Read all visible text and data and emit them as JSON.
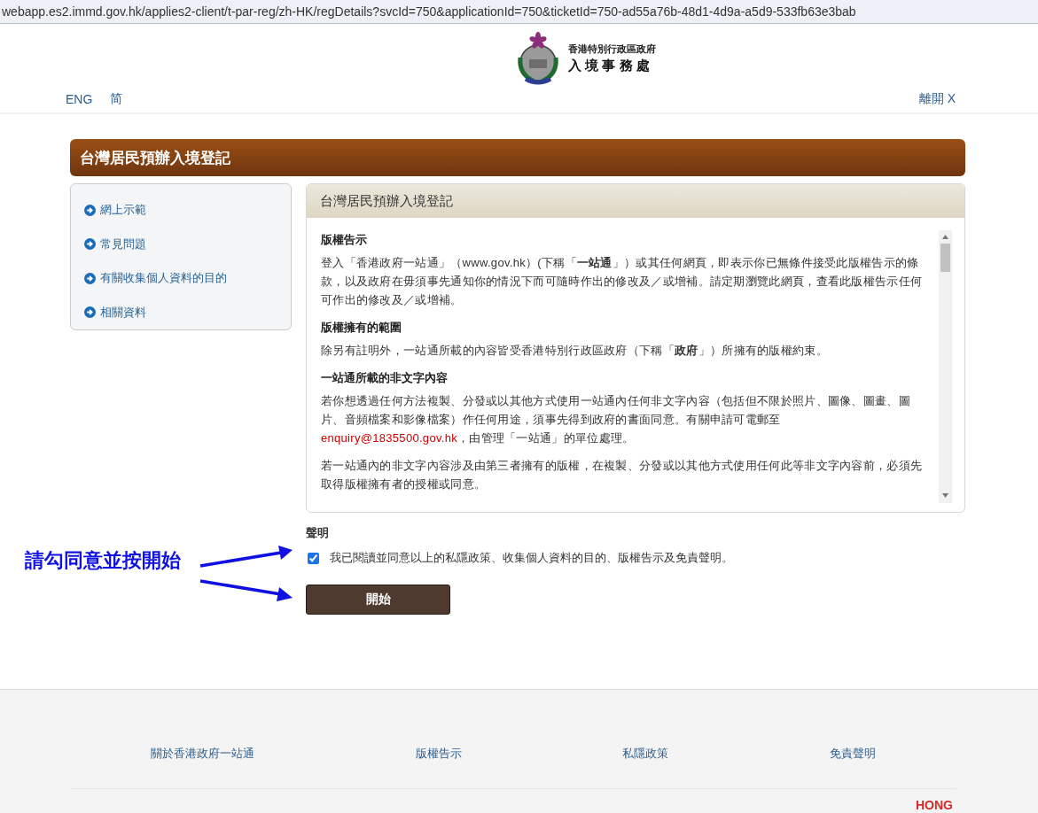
{
  "address_bar": {
    "url": "webapp.es2.immd.gov.hk/applies2-client/t-par-reg/zh-HK/regDetails?svcId=750&applicationId=750&ticketId=750-ad55a76b-48d1-4d9a-a5d9-533fb63e3bab"
  },
  "header": {
    "org_line_1": "香港特別行政區政府",
    "org_line_2": "入 境 事 務 處",
    "languages": [
      "ENG",
      "简"
    ],
    "exit": "離開 X"
  },
  "page_title": "台灣居民預辦入境登記",
  "sidebar": {
    "items": [
      "網上示範",
      "常見問題",
      "有關收集個人資料的目的",
      "相關資料"
    ]
  },
  "panel": {
    "title": "台灣居民預辦入境登記",
    "sections": [
      {
        "heading": "版權告示",
        "paragraphs": [
          [
            {
              "text": "登入「香港政府一站通」（www.gov.hk）(下稱「**一站通**」）或其任何網頁，即表示你已無條件接受此版權告示的條款，以及政府在毋須事先通知你的情況下而可隨時作出的修改及／或增補。請定期瀏覽此網頁，查看此版權告示任何可作出的修改及／或增補。"
            }
          ]
        ]
      },
      {
        "heading": "版權擁有的範圍",
        "paragraphs": [
          [
            {
              "text": "除另有註明外，一站通所載的內容皆受香港特別行政區政府（下稱「**政府**」）所擁有的版權約束。"
            }
          ]
        ]
      },
      {
        "heading": "一站通所載的非文字內容",
        "paragraphs": [
          [
            {
              "text": "若你想透過任何方法複製、分發或以其他方式使用一站通內任何非文字內容（包括但不限於照片、圖像、圖畫、圖片、音頻檔案和影像檔案）作任何用途，須事先得到政府的書面同意。有關申請可電郵至"
            },
            {
              "link": "enquiry@1835500.gov.hk"
            },
            {
              "text": "，由管理「一站通」的單位處理。"
            }
          ],
          [
            {
              "text": "若一站通內的非文字內容涉及由第三者擁有的版權，在複製、分發或以其他方式使用任何此等非文字內容前，必須先取得版權擁有者的授權或同意。"
            }
          ]
        ]
      }
    ]
  },
  "declaration": {
    "title": "聲明",
    "checkbox": {
      "label": "我已閱讀並同意以上的私隱政策、收集個人資料的目的、版權告示及免責聲明。",
      "checked": true
    },
    "button": "開始"
  },
  "annotation": {
    "text": "請勾同意並按開始"
  },
  "footer": {
    "links": [
      "關於香港政府一站通",
      "版權告示",
      "私隱政策",
      "免責聲明"
    ],
    "brand": "HONG"
  }
}
